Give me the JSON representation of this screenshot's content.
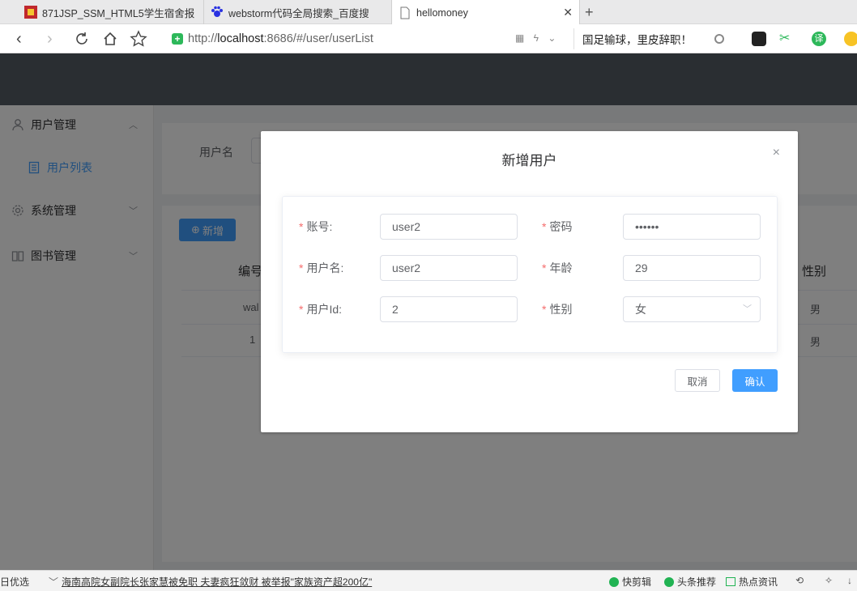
{
  "browser": {
    "tabs": [
      {
        "title": "871JSP_SSM_HTML5学生宿舍报",
        "active": false
      },
      {
        "title": "webstorm代码全局搜索_百度搜",
        "active": false
      },
      {
        "title": "hellomoney",
        "active": true
      }
    ],
    "new_tab": "+",
    "url_prefix": "http://",
    "url_host": "localhost",
    "url_rest": ":8686/#/user/userList",
    "search_text": "国足输球，里皮辞职！",
    "ext_translate": "译"
  },
  "sidebar": {
    "user_mgmt": "用户管理",
    "user_list": "用户列表",
    "system_mgmt": "系统管理",
    "book_mgmt": "图书管理"
  },
  "main": {
    "search_label": "用户名",
    "add_button": "新增",
    "table": {
      "headers": {
        "id": "编号",
        "gender": "性别"
      },
      "rows": [
        {
          "id": "wal",
          "gender": "男"
        },
        {
          "id": "1",
          "gender": "男"
        }
      ]
    }
  },
  "dialog": {
    "title": "新增用户",
    "close": "×",
    "fields": {
      "account_label": "账号:",
      "account_value": "user2",
      "password_label": "密码",
      "password_value": "••••••",
      "username_label": "用户名:",
      "username_value": "user2",
      "age_label": "年龄",
      "age_value": "29",
      "userid_label": "用户Id:",
      "userid_value": "2",
      "gender_label": "性别",
      "gender_value": "女"
    },
    "required_mark": "*",
    "cancel": "取消",
    "confirm": "确认"
  },
  "statusbar": {
    "left": "日优选",
    "news": "海南高院女副院长张家慧被免职 夫妻疯狂敛财 被举报\"家族资产超200亿\"",
    "kuaijian": "快剪辑",
    "toutiao": "头条推荐",
    "hotspot": "热点资讯"
  },
  "colors": {
    "header": "#545c64",
    "primary": "#409eff",
    "required": "#f56c6c"
  }
}
